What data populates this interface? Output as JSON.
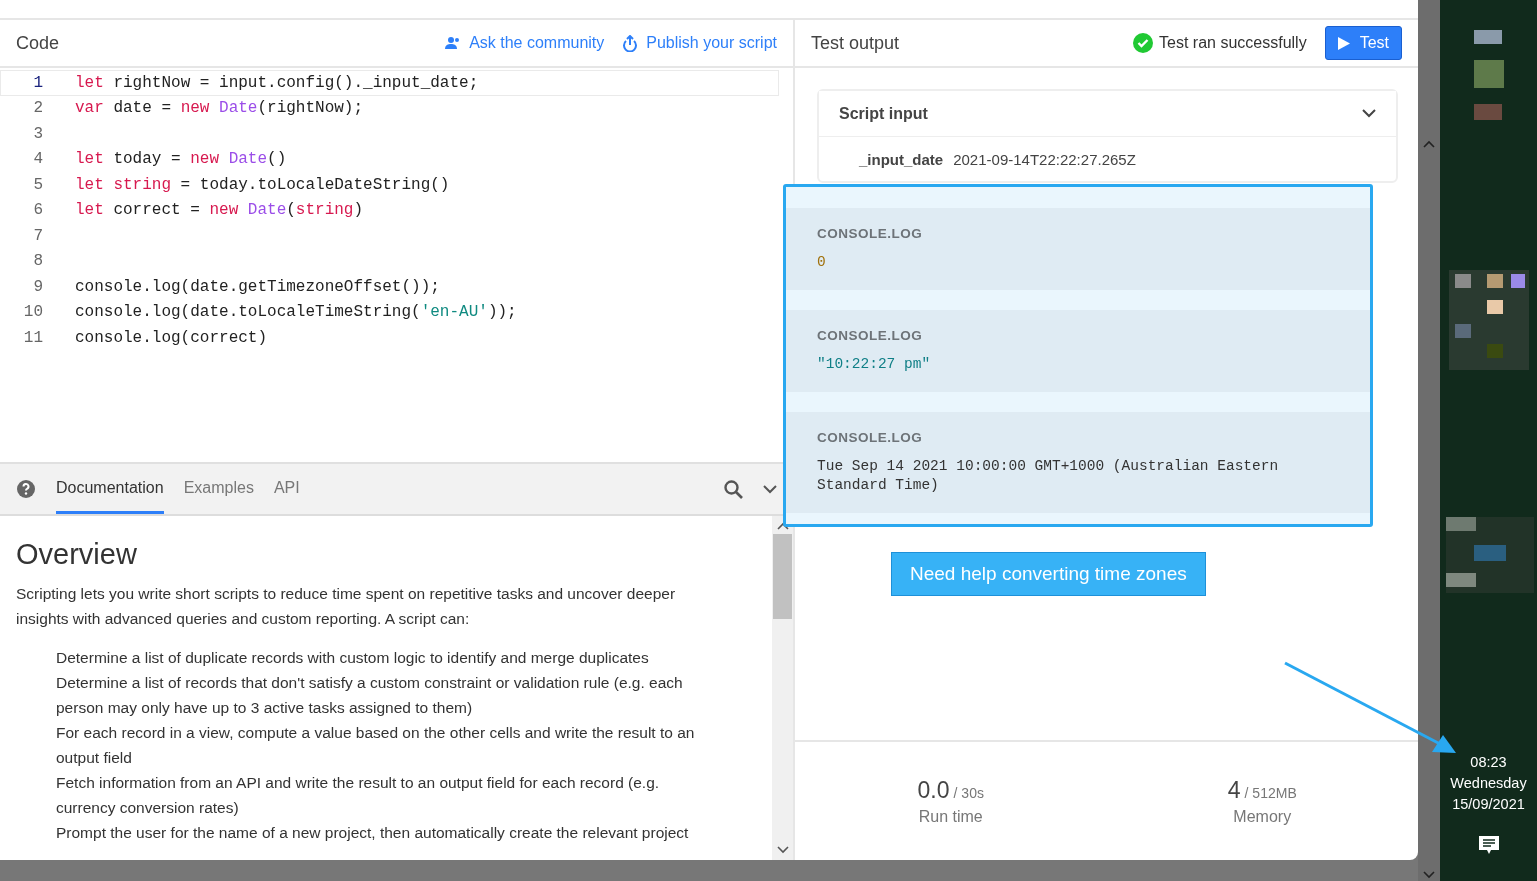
{
  "code_panel": {
    "title": "Code",
    "links": [
      {
        "kind": "community",
        "label": "Ask the community"
      },
      {
        "kind": "publish",
        "label": "Publish your script"
      }
    ],
    "lines": [
      {
        "number": "1",
        "current": true,
        "tokens": [
          {
            "kind": "keyword",
            "text": "let"
          },
          {
            "kind": "plain",
            "text": " rightNow = input.config()._input_date;"
          }
        ]
      },
      {
        "number": "2",
        "current": false,
        "tokens": [
          {
            "kind": "keyword",
            "text": "var"
          },
          {
            "kind": "plain",
            "text": " date = "
          },
          {
            "kind": "keyword",
            "text": "new "
          },
          {
            "kind": "type",
            "text": "Date"
          },
          {
            "kind": "plain",
            "text": "(rightNow);"
          }
        ]
      },
      {
        "number": "3",
        "current": false
      },
      {
        "number": "4",
        "current": false,
        "tokens": [
          {
            "kind": "keyword",
            "text": "let"
          },
          {
            "kind": "plain",
            "text": " today = "
          },
          {
            "kind": "keyword",
            "text": "new "
          },
          {
            "kind": "type",
            "text": "Date"
          },
          {
            "kind": "plain",
            "text": "()"
          }
        ]
      },
      {
        "number": "5",
        "current": false,
        "tokens": [
          {
            "kind": "keyword",
            "text": "let string"
          },
          {
            "kind": "plain",
            "text": " = today.toLocaleDateString()"
          }
        ]
      },
      {
        "number": "6",
        "current": false,
        "tokens": [
          {
            "kind": "keyword",
            "text": "let"
          },
          {
            "kind": "plain",
            "text": " correct = "
          },
          {
            "kind": "keyword",
            "text": "new "
          },
          {
            "kind": "type",
            "text": "Date"
          },
          {
            "kind": "plain",
            "text": "("
          },
          {
            "kind": "keyword",
            "text": "string"
          },
          {
            "kind": "plain",
            "text": ")"
          }
        ]
      },
      {
        "number": "7",
        "current": false
      },
      {
        "number": "8",
        "current": false
      },
      {
        "number": "9",
        "current": false,
        "tokens": [
          {
            "kind": "plain",
            "text": "console.log(date.getTimezoneOffset());"
          }
        ]
      },
      {
        "number": "10",
        "current": false,
        "tokens": [
          {
            "kind": "plain",
            "text": "console.log(date.toLocaleTimeString("
          },
          {
            "kind": "string",
            "text": "'en-AU'"
          },
          {
            "kind": "plain",
            "text": "));"
          }
        ]
      },
      {
        "number": "11",
        "current": false,
        "tokens": [
          {
            "kind": "plain",
            "text": "console.log(correct)"
          }
        ]
      }
    ]
  },
  "docs": {
    "tabs": [
      {
        "label": "Documentation",
        "selected": true
      },
      {
        "label": "Examples",
        "selected": false
      },
      {
        "label": "API",
        "selected": false
      }
    ],
    "heading": "Overview",
    "intro": "Scripting lets you write short scripts to reduce time spent on repetitive tasks and uncover deeper insights with advanced queries and custom reporting. A script can:",
    "items": [
      "Determine a list of duplicate records with custom logic to identify and merge duplicates",
      "Determine a list of records that don't satisfy a custom constraint or validation rule (e.g. each person may only have up to 3 active tasks assigned to them)",
      "For each record in a view, compute a value based on the other cells and write the result to an output field",
      "Fetch information from an API and write the result to an output field for each record (e.g. currency conversion rates)",
      "Prompt the user for the name of a new project, then automatically create the relevant project"
    ]
  },
  "output_panel": {
    "title": "Test output",
    "status": "Test ran successfully",
    "test_button": "Test",
    "script_input": {
      "title": "Script input",
      "expanded": true,
      "name": "_input_date",
      "value": "2021-09-14T22:22:27.265Z"
    },
    "logs": [
      {
        "label": "CONSOLE.LOG",
        "kind": "number",
        "lines": [
          "0"
        ]
      },
      {
        "label": "CONSOLE.LOG",
        "kind": "string",
        "lines": [
          "\"10:22:27 pm\""
        ]
      },
      {
        "label": "CONSOLE.LOG",
        "kind": "plain",
        "lines": [
          "Tue Sep 14 2021 10:00:00 GMT+1000 (Australian Eastern",
          "Standard Time)"
        ]
      }
    ],
    "help_button": "Need help converting time zones",
    "stats": [
      {
        "value": "0.0",
        "limit": "/ 30s",
        "label": "Run time"
      },
      {
        "value": "4",
        "limit": "/ 512MB",
        "label": "Memory"
      }
    ]
  },
  "taskbar": {
    "time": "08:23",
    "day": "Wednesday",
    "date": "15/09/2021"
  }
}
